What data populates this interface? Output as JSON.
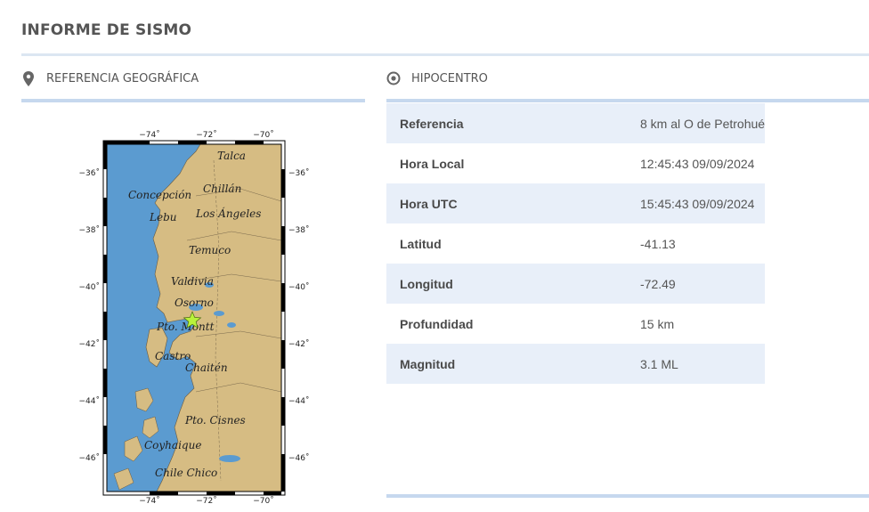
{
  "page_title": "INFORME DE SISMO",
  "geo": {
    "title": "REFERENCIA GEOGRÁFICA",
    "icon": "map-pin-icon",
    "map": {
      "top_ticks": [
        "−74˚",
        "−72˚",
        "−70˚"
      ],
      "bottom_ticks": [
        "−74˚",
        "−72˚",
        "−70˚"
      ],
      "left_ticks": [
        "−36˚",
        "−38˚",
        "−40˚",
        "−42˚",
        "−44˚",
        "−46˚"
      ],
      "right_ticks": [
        "−36˚",
        "−38˚",
        "−40˚",
        "−42˚",
        "−44˚",
        "−46˚"
      ],
      "cities": [
        "Talca",
        "Chillán",
        "Concepción",
        "Lebu",
        "Los Ángeles",
        "Temuco",
        "Valdivia",
        "Osorno",
        "Pto. Montt",
        "Castro",
        "Chaitén",
        "Pto. Cisnes",
        "Coyhaique",
        "Chile Chico"
      ],
      "epicenter_icon": "epicenter-star-icon",
      "colors": {
        "ocean": "#5b9bd0",
        "land": "#d6bc83",
        "epicenter": "#b8f23b"
      }
    }
  },
  "hypo": {
    "title": "HIPOCENTRO",
    "icon": "target-icon",
    "rows": [
      {
        "label": "Referencia",
        "value": "8 km al O de Petrohué"
      },
      {
        "label": "Hora Local",
        "value": "12:45:43 09/09/2024"
      },
      {
        "label": "Hora UTC",
        "value": "15:45:43 09/09/2024"
      },
      {
        "label": "Latitud",
        "value": "-41.13"
      },
      {
        "label": "Longitud",
        "value": "-72.49"
      },
      {
        "label": "Profundidad",
        "value": "15 km"
      },
      {
        "label": "Magnitud",
        "value": "3.1 ML"
      }
    ]
  }
}
